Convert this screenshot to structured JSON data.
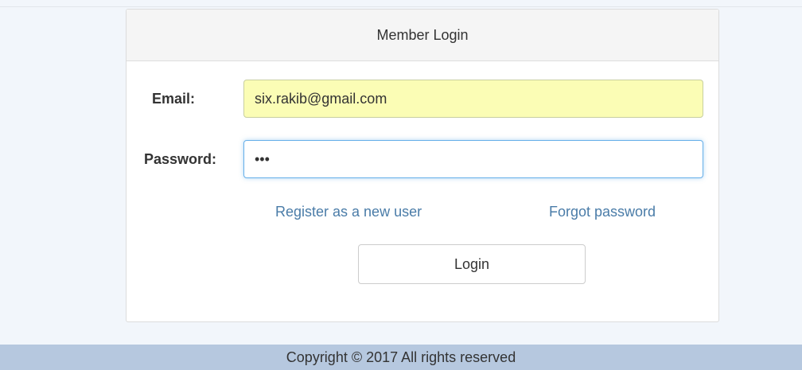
{
  "panel": {
    "title": "Member Login"
  },
  "form": {
    "email_label": "Email:",
    "email_value": "six.rakib@gmail.com",
    "password_label": "Password:",
    "password_value": "abc",
    "register_link": "Register as a new user",
    "forgot_link": "Forgot password",
    "login_label": "Login"
  },
  "footer": {
    "text": "Copyright © 2017 All rights reserved"
  },
  "colors": {
    "autofill_background": "#fbfdb5",
    "focus_border": "#66afe9",
    "link": "#4a7ca8",
    "footer_background": "#b6c8df"
  }
}
